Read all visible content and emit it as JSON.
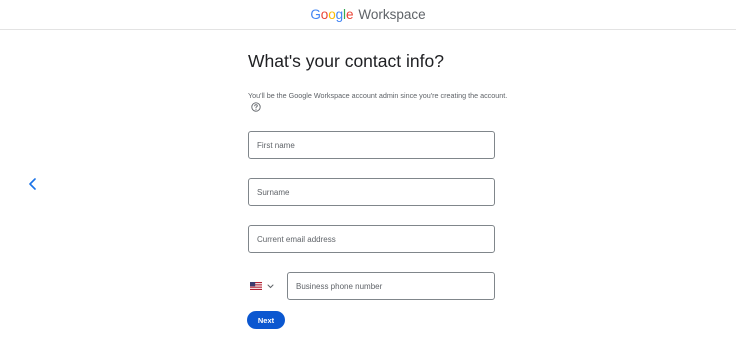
{
  "header": {
    "logo_letters": [
      {
        "char": "G",
        "color": "#4285F4"
      },
      {
        "char": "o",
        "color": "#EA4335"
      },
      {
        "char": "o",
        "color": "#FBBC05"
      },
      {
        "char": "g",
        "color": "#4285F4"
      },
      {
        "char": "l",
        "color": "#34A853"
      },
      {
        "char": "e",
        "color": "#EA4335"
      }
    ],
    "product_name": "Workspace"
  },
  "back_button": {
    "icon": "chevron-left-icon",
    "color": "#1a73e8"
  },
  "page": {
    "title": "What's your contact info?",
    "subtitle": "You'll be the Google Workspace account admin since you're creating the account.",
    "help_icon": "question-circle-icon"
  },
  "form": {
    "first_name": {
      "placeholder": "First name",
      "value": ""
    },
    "surname": {
      "placeholder": "Surname",
      "value": ""
    },
    "email": {
      "placeholder": "Current email address",
      "value": ""
    },
    "country_code": {
      "flag": "us-flag-icon",
      "selected": "US"
    },
    "phone": {
      "placeholder": "Business phone number",
      "value": ""
    }
  },
  "actions": {
    "next_label": "Next"
  },
  "colors": {
    "primary": "#0b57d0",
    "border": "#80868b",
    "text": "#202124",
    "muted": "#5f6368"
  }
}
